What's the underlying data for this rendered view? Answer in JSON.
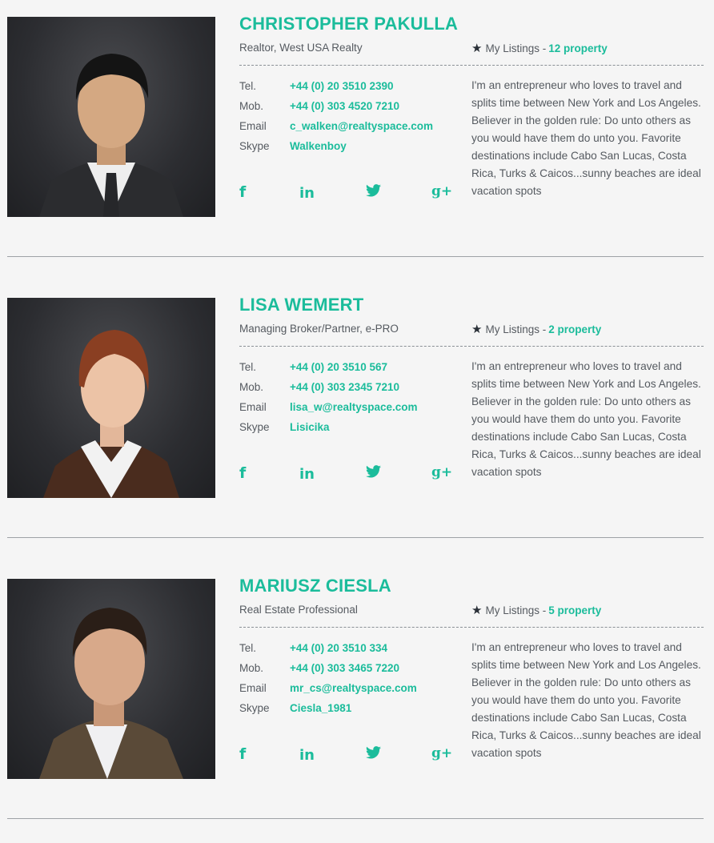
{
  "agents": [
    {
      "name": "CHRISTOPHER PAKULLA",
      "role": "Realtor, West USA Realty",
      "listings_label": "My Listings -",
      "listings_count": "12 property",
      "contacts": {
        "tel_label": "Tel.",
        "tel": "+44 (0) 20 3510 2390",
        "mob_label": "Mob.",
        "mob": "+44 (0) 303 4520 7210",
        "email_label": "Email",
        "email": "c_walken@realtyspace.com",
        "skype_label": "Skype",
        "skype": "Walkenboy"
      },
      "bio": "I'm an entrepreneur who loves to travel and splits time between New York and Los Angeles. Believer in the golden rule: Do unto others as you would have them do unto you. Favorite destinations include Cabo San Lucas, Costa Rica, Turks & Caicos...sunny beaches are ideal vacation spots"
    },
    {
      "name": "LISA WEMERT",
      "role": "Managing Broker/Partner, e-PRO",
      "listings_label": "My Listings -",
      "listings_count": "2 property",
      "contacts": {
        "tel_label": "Tel.",
        "tel": "+44 (0) 20 3510 567",
        "mob_label": "Mob.",
        "mob": "+44 (0) 303 2345 7210",
        "email_label": "Email",
        "email": "lisa_w@realtyspace.com",
        "skype_label": "Skype",
        "skype": "Lisicika"
      },
      "bio": "I'm an entrepreneur who loves to travel and splits time between New York and Los Angeles. Believer in the golden rule: Do unto others as you would have them do unto you. Favorite destinations include Cabo San Lucas, Costa Rica, Turks & Caicos...sunny beaches are ideal vacation spots"
    },
    {
      "name": "MARIUSZ CIESLA",
      "role": "Real Estate Professional",
      "listings_label": "My Listings -",
      "listings_count": "5 property",
      "contacts": {
        "tel_label": "Tel.",
        "tel": "+44 (0) 20 3510 334",
        "mob_label": "Mob.",
        "mob": "+44 (0) 303 3465 7220",
        "email_label": "Email",
        "email": "mr_cs@realtyspace.com",
        "skype_label": "Skype",
        "skype": "Ciesla_1981"
      },
      "bio": "I'm an entrepreneur who loves to travel and splits time between New York and Los Angeles. Believer in the golden rule: Do unto others as you would have them do unto you. Favorite destinations include Cabo San Lucas, Costa Rica, Turks & Caicos...sunny beaches are ideal vacation spots"
    }
  ],
  "icons": {
    "star": "star-icon",
    "facebook": "facebook-icon",
    "linkedin": "linkedin-icon",
    "twitter": "twitter-icon",
    "googleplus": "google-plus-icon"
  },
  "colors": {
    "accent": "#1bbc9b",
    "text": "#555a60",
    "background": "#f5f5f5"
  }
}
